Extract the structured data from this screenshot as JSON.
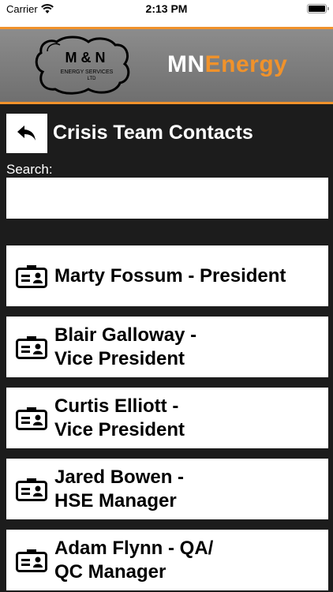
{
  "status_bar": {
    "carrier": "Carrier",
    "time": "2:13 PM"
  },
  "header": {
    "logo_text": {
      "line1": "M & N",
      "line2": "ENERGY SERVICES",
      "line3": "LTD"
    },
    "brand_mn": "MN",
    "brand_energy": "Energy",
    "accent_color": "#f0922b"
  },
  "page": {
    "title": "Crisis Team Contacts",
    "back_icon": "back-arrow-icon"
  },
  "search": {
    "label": "Search:",
    "value": "",
    "placeholder": ""
  },
  "contacts": [
    {
      "name": "Marty Fossum - President",
      "icon": "contact-card-icon"
    },
    {
      "name": "Blair Galloway -\nVice President",
      "icon": "contact-card-icon"
    },
    {
      "name": "Curtis Elliott -\nVice President",
      "icon": "contact-card-icon"
    },
    {
      "name": "Jared Bowen -\nHSE Manager",
      "icon": "contact-card-icon"
    },
    {
      "name": "Adam Flynn - QA/\nQC Manager",
      "icon": "contact-card-icon"
    }
  ]
}
